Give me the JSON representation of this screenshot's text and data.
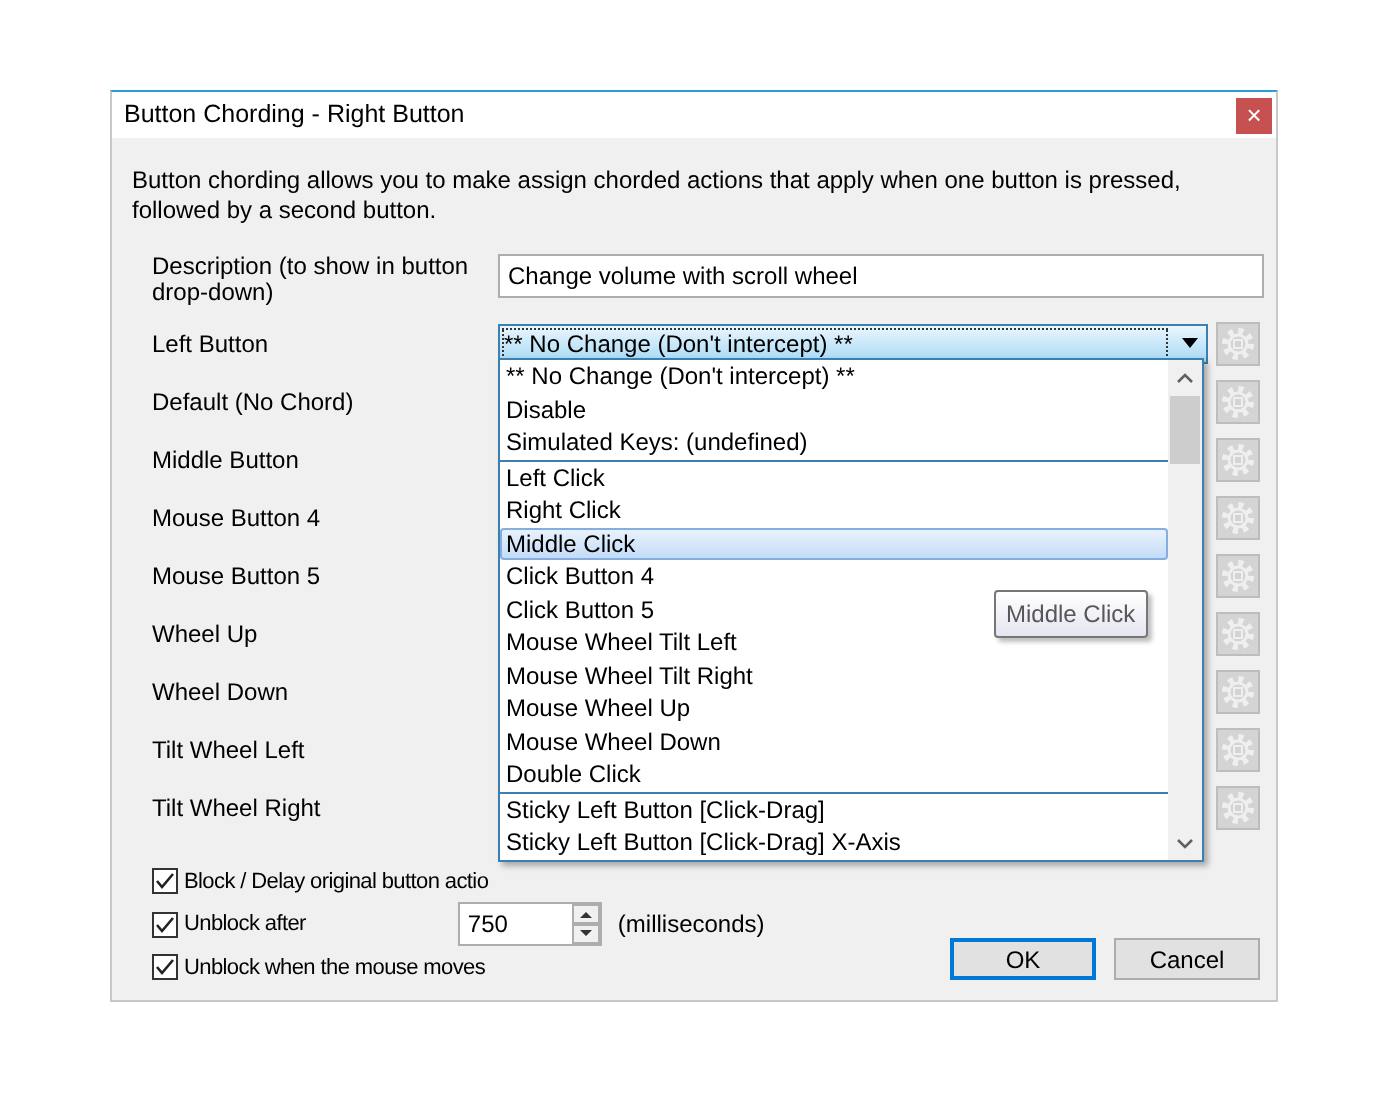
{
  "window": {
    "title": "Button Chording - Right Button",
    "close": "×"
  },
  "intro": "Button chording allows you to make assign chorded actions that apply when one button is pressed, followed by a second button.",
  "description": {
    "label": "Description (to show in button drop-down)",
    "value": "Change volume with scroll wheel"
  },
  "rows": [
    {
      "label": "Left Button",
      "value": "** No Change (Don't intercept) **",
      "expanded": true
    },
    {
      "label": "Default (No Chord)"
    },
    {
      "label": "Middle Button"
    },
    {
      "label": "Mouse Button 4"
    },
    {
      "label": "Mouse Button 5"
    },
    {
      "label": "Wheel Up"
    },
    {
      "label": "Wheel Down"
    },
    {
      "label": "Tilt Wheel Left"
    },
    {
      "label": "Tilt Wheel Right"
    }
  ],
  "dropdown": {
    "groups": [
      [
        {
          "label": "** No Change (Don't intercept) **",
          "selected": false
        },
        {
          "label": "Disable",
          "selected": false
        },
        {
          "label": "Simulated Keys: (undefined)",
          "selected": false
        }
      ],
      [
        {
          "label": "Left Click",
          "selected": false
        },
        {
          "label": "Right Click",
          "selected": false
        },
        {
          "label": "Middle Click",
          "selected": true
        },
        {
          "label": "Click Button 4",
          "selected": false
        },
        {
          "label": "Click Button 5",
          "selected": false
        },
        {
          "label": "Mouse Wheel Tilt Left",
          "selected": false
        },
        {
          "label": "Mouse Wheel Tilt Right",
          "selected": false
        },
        {
          "label": "Mouse Wheel Up",
          "selected": false
        },
        {
          "label": "Mouse Wheel Down",
          "selected": false
        },
        {
          "label": "Double Click",
          "selected": false
        }
      ],
      [
        {
          "label": "Sticky Left Button [Click-Drag]",
          "selected": false
        },
        {
          "label": "Sticky Left Button [Click-Drag] X-Axis",
          "selected": false
        }
      ]
    ],
    "tooltip": "Middle Click"
  },
  "options": [
    {
      "label": "Block / Delay original button actio",
      "checked": true
    },
    {
      "label": "Unblock after",
      "checked": true,
      "spin_value": "750",
      "unit": "(milliseconds)"
    },
    {
      "label": "Unblock when the mouse moves",
      "checked": true
    }
  ],
  "buttons": [
    {
      "label": "OK",
      "default": true
    },
    {
      "label": "Cancel",
      "default": false
    }
  ]
}
